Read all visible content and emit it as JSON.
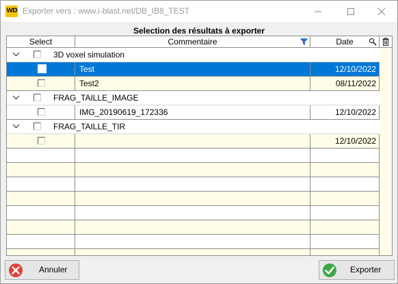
{
  "window": {
    "title": "Exporter vers : www.i-blast.net/DB_IB8_TEST",
    "app_icon_label": "WD",
    "icon_name": "windev-app-icon"
  },
  "header": {
    "title": "Selection des résultats à exporter"
  },
  "table": {
    "columns": {
      "select": "Select",
      "comment": "Commentaire",
      "date": "Date"
    },
    "groups": [
      {
        "label": "3D voxel simulation",
        "items": [
          {
            "comment": "Test",
            "date": "12/10/2022",
            "selected": true
          },
          {
            "comment": "Test2",
            "date": "08/11/2022",
            "selected": false
          }
        ]
      },
      {
        "label": "FRAG_TAILLE_IMAGE",
        "items": [
          {
            "comment": "IMG_20190619_172336",
            "date": "12/10/2022",
            "selected": false
          }
        ]
      },
      {
        "label": "FRAG_TAILLE_TIR",
        "items": [
          {
            "comment": "",
            "date": "12/10/2022",
            "selected": false
          }
        ]
      }
    ]
  },
  "buttons": {
    "cancel_label": "Annuler",
    "export_label": "Exporter"
  },
  "colors": {
    "selection": "#0078d7",
    "row_fill": "#fffde8",
    "cancel_icon": "#e0413a",
    "export_icon": "#3aa845",
    "app_icon": "#f5c400"
  }
}
